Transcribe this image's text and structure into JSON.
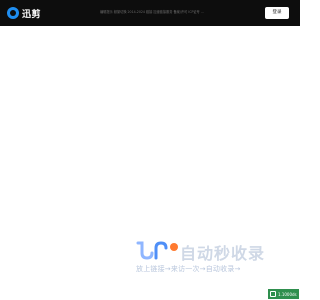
{
  "header": {
    "logo_text": "迅剪",
    "notice": "编辑提示 频繁切换 2014-2024 链接 加速链接服务 备案/许可 ICP证号 ...",
    "login_label": "登录"
  },
  "brand": {
    "title": "自动秒收录",
    "slogan": "放上链接→来访一次→自动收录→",
    "accent_color": "#4f8ff7",
    "title_color": "#cfd8e6"
  },
  "badge": {
    "icon": "shield-icon",
    "text": "1.1000ds",
    "color": "#2f8f4e"
  }
}
